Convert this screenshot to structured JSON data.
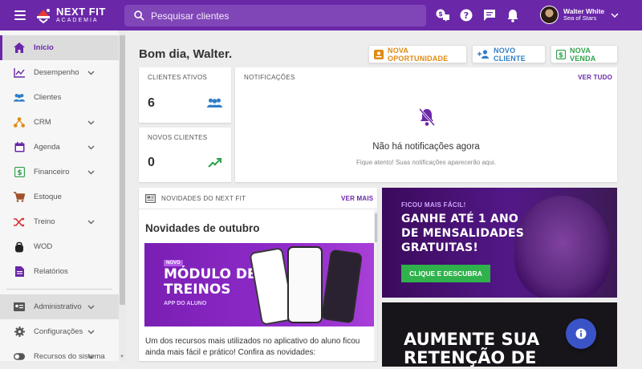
{
  "app": {
    "logo_line1": "NEXT FIT",
    "logo_line2": "ACADEMIA",
    "search_placeholder": "Pesquisar clientes",
    "user_name": "Walter White",
    "user_subtitle": "Sea of Stars",
    "brand_color": "#6a27a8"
  },
  "sidebar": {
    "items": [
      {
        "label": "Início",
        "icon": "home-icon"
      },
      {
        "label": "Desempenho",
        "icon": "chart-line-icon"
      },
      {
        "label": "Clientes",
        "icon": "people-icon"
      },
      {
        "label": "CRM",
        "icon": "hierarchy-icon"
      },
      {
        "label": "Agenda",
        "icon": "calendar-icon"
      },
      {
        "label": "Financeiro",
        "icon": "money-icon"
      },
      {
        "label": "Estoque",
        "icon": "cart-icon"
      },
      {
        "label": "Treino",
        "icon": "shuffle-icon"
      },
      {
        "label": "WOD",
        "icon": "kettlebell-icon"
      },
      {
        "label": "Relatórios",
        "icon": "document-icon"
      },
      {
        "label": "Administrativo",
        "icon": "id-card-icon"
      },
      {
        "label": "Configurações",
        "icon": "gear-icon"
      },
      {
        "label": "Recursos do sistema",
        "icon": "toggle-icon"
      }
    ]
  },
  "main": {
    "greeting": "Bom dia, Walter.",
    "actions": [
      {
        "label": "NOVA OPORTUNIDADE",
        "color": "#e08a12"
      },
      {
        "label": "NOVO CLIENTE",
        "color": "#2f7ec7"
      },
      {
        "label": "NOVA VENDA",
        "color": "#2ea34a"
      }
    ],
    "clientes_ativos": {
      "title": "CLIENTES ATIVOS",
      "value": "6"
    },
    "novos_clientes": {
      "title": "NOVOS CLIENTES",
      "value": "0"
    },
    "notificacoes": {
      "title": "NOTIFICAÇÕES",
      "link": "VER TUDO",
      "empty_title": "Não há notificações agora",
      "empty_sub": "Fique atento! Suas notificações aparecerão aqui."
    },
    "novidades": {
      "title": "NOVIDADES DO NEXT FIT",
      "link": "VER MAIS",
      "heading": "Novidades de outubro",
      "image_tag": "NOVO",
      "image_title": "MÓDULO DE TREINOS",
      "image_sub": "APP DO ALUNO",
      "text": "Um dos recursos mais utilizados no aplicativo do aluno ficou ainda mais fácil e prático! Confira as novidades:"
    },
    "promo1": {
      "tag": "FICOU MAIS FÁCIL!",
      "headline": "GANHE ATÉ 1 ANO DE MENSALIDADES GRATUITAS!",
      "cta": "CLIQUE E DESCUBRA"
    },
    "promo2": {
      "headline": "AUMENTE SUA RETENÇÃO DE"
    }
  }
}
